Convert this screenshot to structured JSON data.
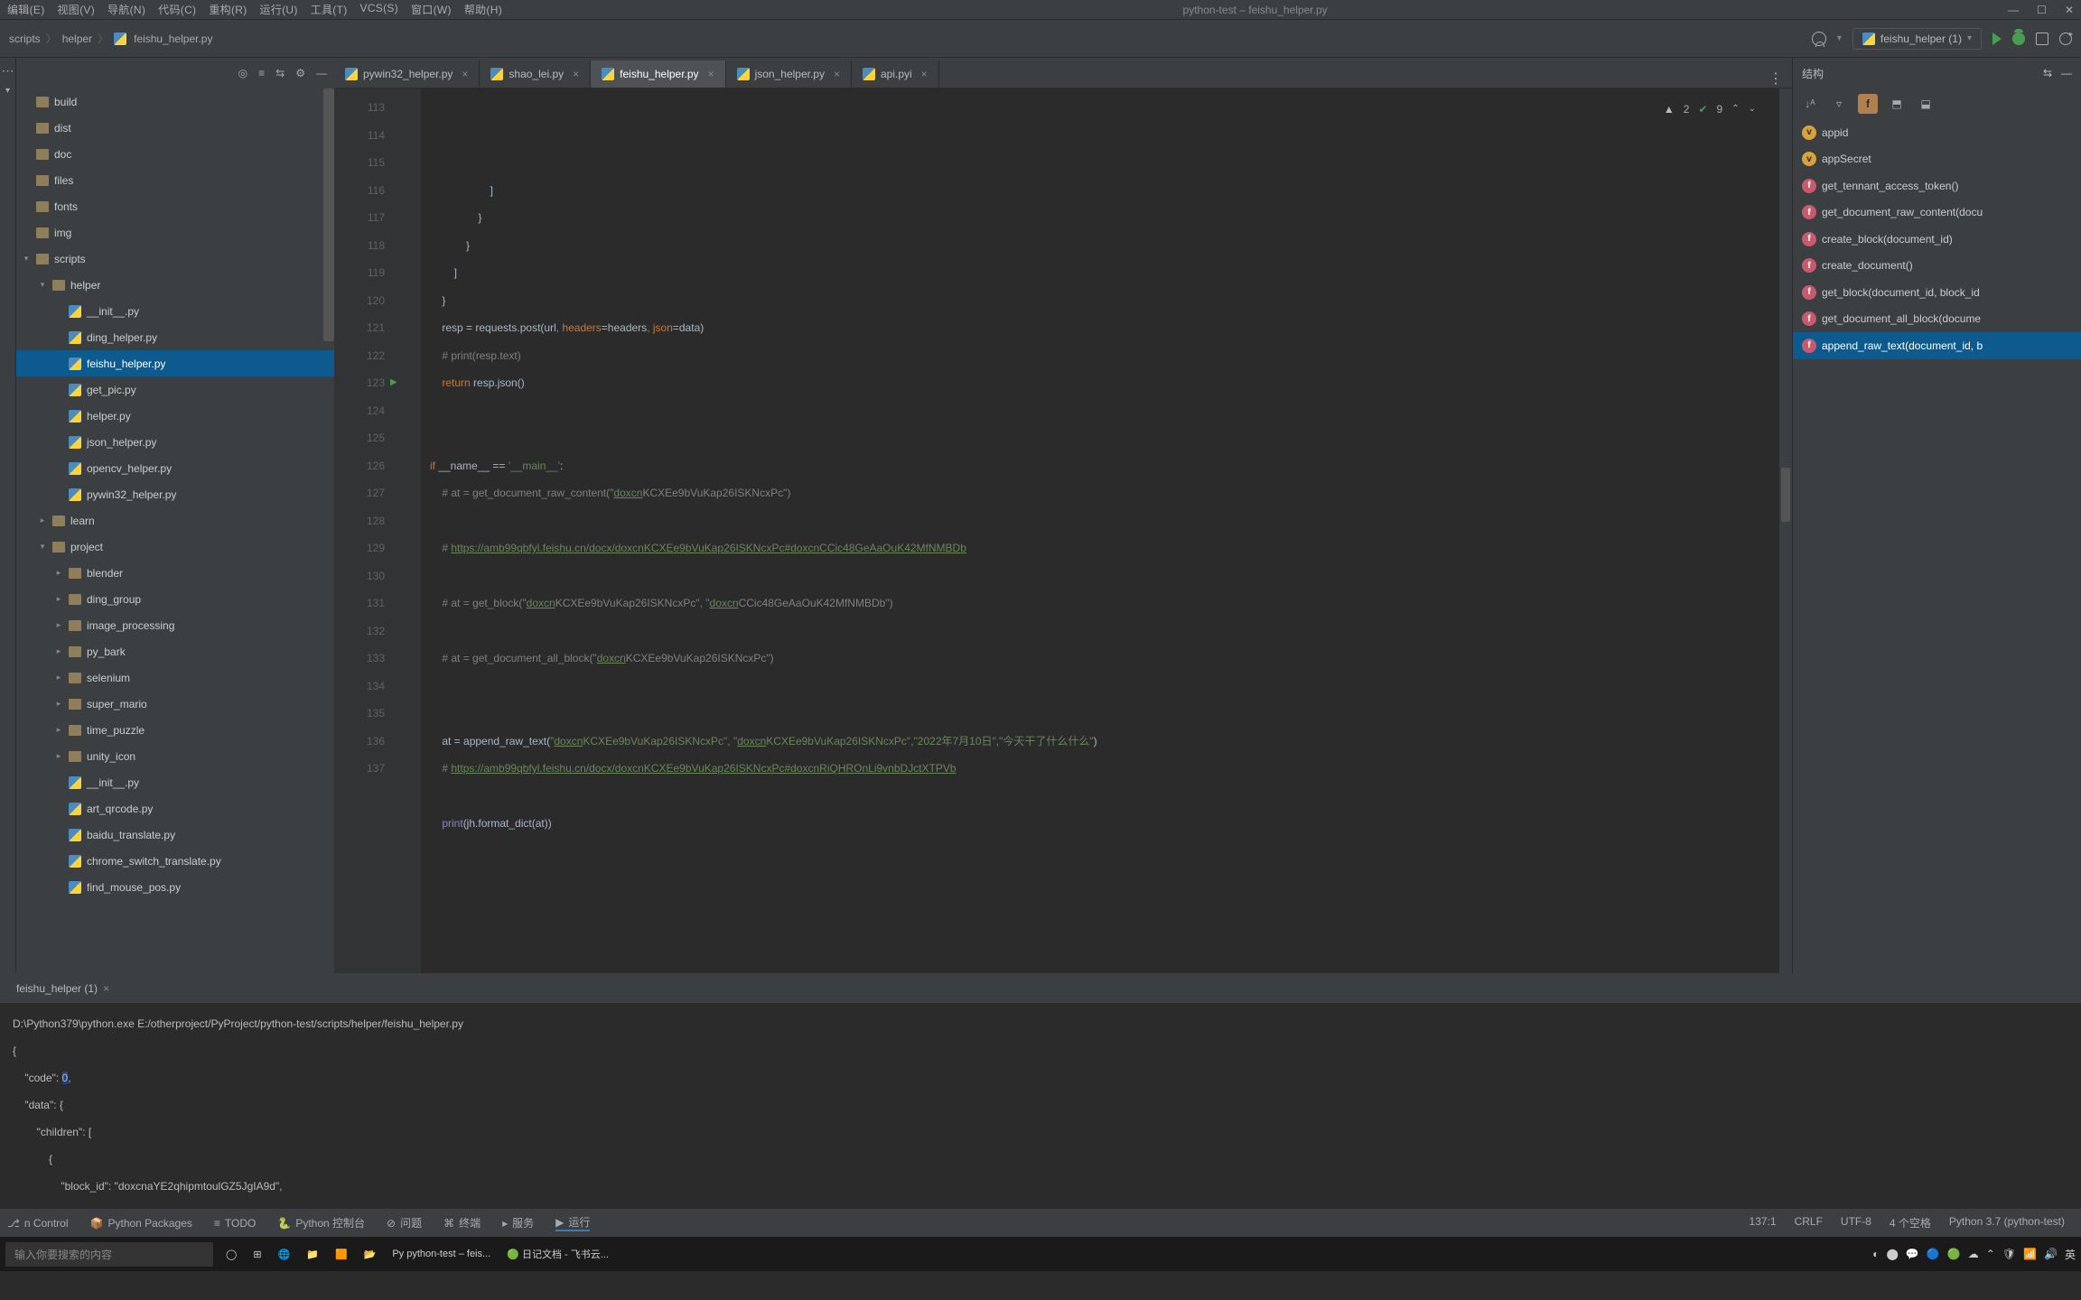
{
  "menu": [
    "编辑(E)",
    "视图(V)",
    "导航(N)",
    "代码(C)",
    "重构(R)",
    "运行(U)",
    "工具(T)",
    "VCS(S)",
    "窗口(W)",
    "帮助(H)"
  ],
  "window_title": "python-test – feishu_helper.py",
  "crumb": [
    "scripts",
    "helper",
    "feishu_helper.py"
  ],
  "run_config": "feishu_helper (1)",
  "project_tree": [
    {
      "kind": "folder",
      "indent": 0,
      "name": "build",
      "exp": ""
    },
    {
      "kind": "folder",
      "indent": 0,
      "name": "dist",
      "exp": ""
    },
    {
      "kind": "folder",
      "indent": 0,
      "name": "doc",
      "exp": ""
    },
    {
      "kind": "folder",
      "indent": 0,
      "name": "files",
      "exp": ""
    },
    {
      "kind": "folder",
      "indent": 0,
      "name": "fonts",
      "exp": ""
    },
    {
      "kind": "folder",
      "indent": 0,
      "name": "img",
      "exp": ""
    },
    {
      "kind": "folder",
      "indent": 0,
      "name": "scripts",
      "exp": "▾"
    },
    {
      "kind": "folder",
      "indent": 1,
      "name": "helper",
      "exp": "▾"
    },
    {
      "kind": "file",
      "indent": 2,
      "name": "__init__.py"
    },
    {
      "kind": "file",
      "indent": 2,
      "name": "ding_helper.py"
    },
    {
      "kind": "file",
      "indent": 2,
      "name": "feishu_helper.py",
      "sel": true
    },
    {
      "kind": "file",
      "indent": 2,
      "name": "get_pic.py"
    },
    {
      "kind": "file",
      "indent": 2,
      "name": "helper.py"
    },
    {
      "kind": "file",
      "indent": 2,
      "name": "json_helper.py"
    },
    {
      "kind": "file",
      "indent": 2,
      "name": "opencv_helper.py"
    },
    {
      "kind": "file",
      "indent": 2,
      "name": "pywin32_helper.py"
    },
    {
      "kind": "folder",
      "indent": 1,
      "name": "learn",
      "exp": "▸"
    },
    {
      "kind": "folder",
      "indent": 1,
      "name": "project",
      "exp": "▾"
    },
    {
      "kind": "folder",
      "indent": 2,
      "name": "blender",
      "exp": "▸"
    },
    {
      "kind": "folder",
      "indent": 2,
      "name": "ding_group",
      "exp": "▸"
    },
    {
      "kind": "folder",
      "indent": 2,
      "name": "image_processing",
      "exp": "▸"
    },
    {
      "kind": "folder",
      "indent": 2,
      "name": "py_bark",
      "exp": "▸"
    },
    {
      "kind": "folder",
      "indent": 2,
      "name": "selenium",
      "exp": "▸"
    },
    {
      "kind": "folder",
      "indent": 2,
      "name": "super_mario",
      "exp": "▸"
    },
    {
      "kind": "folder",
      "indent": 2,
      "name": "time_puzzle",
      "exp": "▸"
    },
    {
      "kind": "folder",
      "indent": 2,
      "name": "unity_icon",
      "exp": "▸"
    },
    {
      "kind": "file",
      "indent": 2,
      "name": "__init__.py"
    },
    {
      "kind": "file",
      "indent": 2,
      "name": "art_qrcode.py"
    },
    {
      "kind": "file",
      "indent": 2,
      "name": "baidu_translate.py"
    },
    {
      "kind": "file",
      "indent": 2,
      "name": "chrome_switch_translate.py"
    },
    {
      "kind": "file",
      "indent": 2,
      "name": "find_mouse_pos.py"
    }
  ],
  "tabs": [
    {
      "name": "pywin32_helper.py"
    },
    {
      "name": "shao_lei.py"
    },
    {
      "name": "feishu_helper.py",
      "active": true
    },
    {
      "name": "json_helper.py"
    },
    {
      "name": "api.pyi"
    }
  ],
  "inspection": {
    "warn_count": "2",
    "check_count": "9"
  },
  "code_lines": [
    {
      "n": 113,
      "html": "                    ]"
    },
    {
      "n": 114,
      "html": "                }"
    },
    {
      "n": 115,
      "html": "            }"
    },
    {
      "n": 116,
      "html": "        ]"
    },
    {
      "n": 117,
      "html": "    }"
    },
    {
      "n": 118,
      "html": "    resp = requests.post(url<span class='cmt'>,</span> <span class='param'>headers</span>=headers<span class='cmt'>,</span> <span class='param'>json</span>=data)"
    },
    {
      "n": 119,
      "html": "    <span class='cmt'># print(resp.text)</span>"
    },
    {
      "n": 120,
      "html": "    <span class='kw'>return</span> resp.json()"
    },
    {
      "n": 121,
      "html": ""
    },
    {
      "n": 122,
      "html": ""
    },
    {
      "n": 123,
      "html": "<span class='kw'>if</span> __name__ == <span class='str'>'__main__'</span>:",
      "run": true
    },
    {
      "n": 124,
      "html": "    <span class='cmt'># at = get_document_raw_content(\"</span><span class='str-u'>doxcn</span><span class='cmt'>KCXEe9bVuKap26ISKNcxPc\")</span>"
    },
    {
      "n": 125,
      "html": ""
    },
    {
      "n": 126,
      "html": "    <span class='cmt'># </span><span class='str-u'>https://amb99qbfyl.feishu.cn/docx/doxcnKCXEe9bVuKap26ISKNcxPc#doxcnCCic48GeAaOuK42MfNMBDb</span>"
    },
    {
      "n": 127,
      "html": ""
    },
    {
      "n": 128,
      "html": "    <span class='cmt'># at = get_block(\"</span><span class='str-u'>doxcn</span><span class='cmt'>KCXEe9bVuKap26ISKNcxPc\", \"</span><span class='str-u'>doxcn</span><span class='cmt'>CCic48GeAaOuK42MfNMBDb\")</span>"
    },
    {
      "n": 129,
      "html": ""
    },
    {
      "n": 130,
      "html": "    <span class='cmt'># at = get_document_all_block(\"</span><span class='str-u'>doxcn</span><span class='cmt'>KCXEe9bVuKap26ISKNcxPc\")</span>"
    },
    {
      "n": 131,
      "html": ""
    },
    {
      "n": 132,
      "html": ""
    },
    {
      "n": 133,
      "html": "    at = append_raw_text(<span class='str'>\"</span><span class='str-u'>doxcn</span><span class='str'>KCXEe9bVuKap26ISKNcxPc\"</span><span class='cmt'>,</span> <span class='str'>\"</span><span class='str-u'>doxcn</span><span class='str'>KCXEe9bVuKap26ISKNcxPc\"</span><span class='cmt'>,</span><span class='str'>\"2022年7月10日\"</span><span class='cmt'>,</span><span class='str'>\"今天干了什么什么\"</span>)"
    },
    {
      "n": 134,
      "html": "    <span class='cmt'># </span><span class='str-u'>https://amb99qbfyl.feishu.cn/docx/doxcnKCXEe9bVuKap26ISKNcxPc#doxcnRiQHROnLi9vnbDJctXTPVb</span>"
    },
    {
      "n": 135,
      "html": ""
    },
    {
      "n": 136,
      "html": "    <span class='builtin'>print</span>(jh.format_dict(at))"
    },
    {
      "n": 137,
      "html": ""
    }
  ],
  "structure_title": "结构",
  "structure_items": [
    {
      "kind": "v",
      "label": "appid"
    },
    {
      "kind": "v",
      "label": "appSecret"
    },
    {
      "kind": "f",
      "label": "get_tennant_access_token()"
    },
    {
      "kind": "f",
      "label": "get_document_raw_content(docu"
    },
    {
      "kind": "f",
      "label": "create_block(document_id)"
    },
    {
      "kind": "f",
      "label": "create_document()"
    },
    {
      "kind": "f",
      "label": "get_block(document_id, block_id"
    },
    {
      "kind": "f",
      "label": "get_document_all_block(docume"
    },
    {
      "kind": "f",
      "label": "append_raw_text(document_id, b",
      "sel": true
    }
  ],
  "run_tab": "feishu_helper (1)",
  "console_lines": [
    "D:\\Python379\\python.exe E:/otherproject/PyProject/python-test/scripts/helper/feishu_helper.py",
    "{",
    "    \"code\": 0,",
    "    \"data\": {",
    "        \"children\": [",
    "            {",
    "                \"block_id\": \"doxcnaYE2qhipmtoulGZ5JgIA9d\","
  ],
  "bottom_tabs": [
    {
      "ico": "⎇",
      "label": "n Control"
    },
    {
      "ico": "📦",
      "label": "Python Packages"
    },
    {
      "ico": "≡",
      "label": "TODO"
    },
    {
      "ico": "🐍",
      "label": "Python 控制台"
    },
    {
      "ico": "⊘",
      "label": "问题"
    },
    {
      "ico": "⌘",
      "label": "终端"
    },
    {
      "ico": "▸",
      "label": "服务"
    },
    {
      "ico": "▶",
      "label": "运行",
      "active": true
    }
  ],
  "status": {
    "pos": "137:1",
    "lf": "CRLF",
    "enc": "UTF-8",
    "indent": "4 个空格",
    "sdk": "Python 3.7 (python-test)"
  },
  "taskbar": {
    "search_placeholder": "输入你要搜索的内容",
    "apps": [
      "◯",
      "⊞",
      "🌐",
      "📁",
      "🟧",
      "📂",
      "Py python-test – feis...",
      "🟢 日记文档 - 飞书云..."
    ]
  }
}
